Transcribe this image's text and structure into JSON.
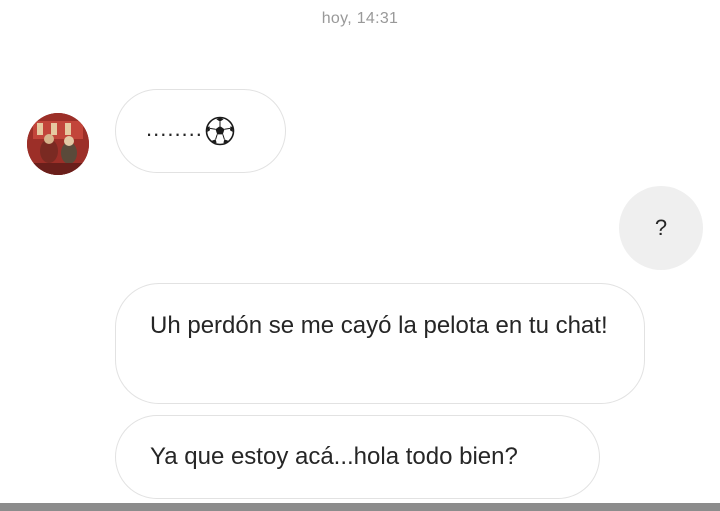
{
  "chat": {
    "timestamp": "hoy, 14:31",
    "messages": [
      {
        "sender": "other",
        "text": "........",
        "emoji": "soccer-ball-icon"
      },
      {
        "sender": "me",
        "text": "?"
      },
      {
        "sender": "other",
        "text": "Uh perdón se me cayó la pelota en tu chat!"
      },
      {
        "sender": "other",
        "text": "Ya que estoy acá...hola todo bien?"
      }
    ]
  },
  "colors": {
    "incoming_bubble_border": "#e2e2e2",
    "outgoing_bubble_bg": "#efefef",
    "timestamp_text": "#999999",
    "message_text": "#262626"
  }
}
